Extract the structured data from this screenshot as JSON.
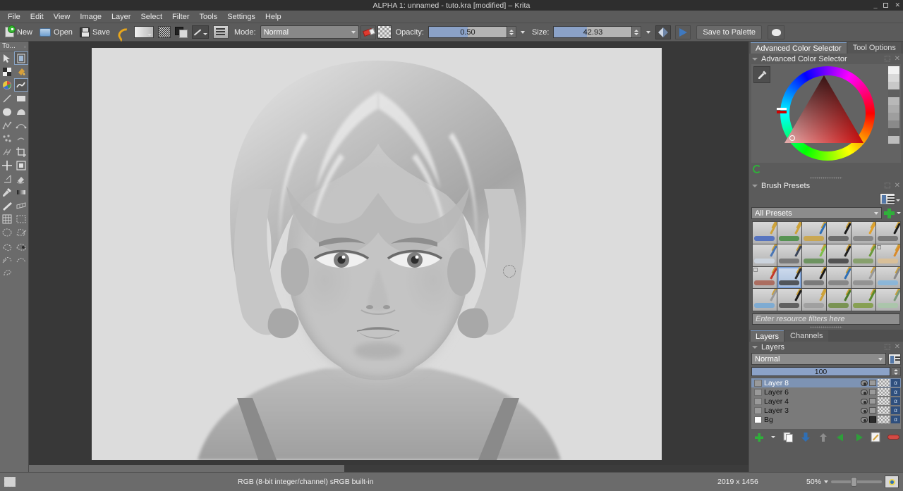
{
  "window": {
    "title": "ALPHA 1: unnamed - tuto.kra [modified] – Krita",
    "minimize": "—",
    "maximize": "□",
    "close": "✕"
  },
  "menubar": {
    "items": [
      {
        "label": "File"
      },
      {
        "label": "Edit"
      },
      {
        "label": "View"
      },
      {
        "label": "Image"
      },
      {
        "label": "Layer"
      },
      {
        "label": "Select"
      },
      {
        "label": "Filter"
      },
      {
        "label": "Tools"
      },
      {
        "label": "Settings"
      },
      {
        "label": "Help"
      }
    ]
  },
  "toolbar": {
    "new_label": "New",
    "open_label": "Open",
    "save_label": "Save",
    "mode_label": "Mode:",
    "mode_value": "Normal",
    "opacity_label": "Opacity:",
    "opacity_value": "0.50",
    "opacity_percent": 50,
    "size_label": "Size:",
    "size_value": "42.93",
    "size_percent": 42,
    "save_to_palette": "Save to Palette",
    "icons": [
      "new-document-icon",
      "open-document-icon",
      "save-document-icon",
      "undo-icon",
      "gradient-swatch-icon",
      "pattern-swatch-icon",
      "foreground-background-color-icon",
      "brush-preset-icon",
      "brush-editor-icon",
      "eraser-toggle-icon",
      "preserve-alpha-icon",
      "mirror-horizontal-icon",
      "wrap-around-icon",
      "workspace-icon"
    ]
  },
  "toolbox": {
    "title": "To...",
    "tools": [
      {
        "name": "select-shapes-tool",
        "selected": false
      },
      {
        "name": "transform-tool",
        "selected": true
      },
      {
        "name": "gradient-tool",
        "selected": false
      },
      {
        "name": "fill-tool",
        "selected": false
      },
      {
        "name": "color-sampler-tool",
        "selected": false
      },
      {
        "name": "freehand-brush-tool",
        "selected": true
      },
      {
        "name": "line-tool",
        "selected": false
      },
      {
        "name": "rectangle-tool",
        "selected": false
      },
      {
        "name": "ellipse-tool",
        "selected": false
      },
      {
        "name": "polygon-tool",
        "selected": false
      },
      {
        "name": "polyline-tool",
        "selected": false
      },
      {
        "name": "bezier-curve-tool",
        "selected": false
      },
      {
        "name": "freehand-path-tool",
        "selected": false
      },
      {
        "name": "dynamic-brush-tool",
        "selected": false
      },
      {
        "name": "multibrush-tool",
        "selected": false
      },
      {
        "name": "crop-tool",
        "selected": false
      },
      {
        "name": "move-tool",
        "selected": false
      },
      {
        "name": "transform-mask-tool",
        "selected": false
      },
      {
        "name": "measure-tool",
        "selected": false
      },
      {
        "name": "fill-bucket-tool",
        "selected": false
      },
      {
        "name": "color-picker-tool",
        "selected": false
      },
      {
        "name": "gradient-edit-tool",
        "selected": false
      },
      {
        "name": "assistant-tool",
        "selected": false
      },
      {
        "name": "perspective-grid-tool",
        "selected": false
      },
      {
        "name": "grid-tool",
        "selected": false
      },
      {
        "name": "select-rectangular-tool",
        "selected": false
      },
      {
        "name": "select-elliptical-tool",
        "selected": false
      },
      {
        "name": "select-polygonal-tool",
        "selected": false
      },
      {
        "name": "select-freehand-tool",
        "selected": false
      },
      {
        "name": "select-contiguous-tool",
        "selected": false
      },
      {
        "name": "select-similar-tool",
        "selected": false
      },
      {
        "name": "select-bezier-tool",
        "selected": false
      },
      {
        "name": "select-magnetic-tool",
        "selected": false
      }
    ]
  },
  "canvas": {
    "artwork_description": "grayscale portrait painting of a short-haired figure",
    "scrollbar": "horizontal-scrollbar",
    "cursor": "brush-outline-cursor"
  },
  "docker": {
    "top_tabs": [
      {
        "label": "Advanced Color Selector",
        "active": true
      },
      {
        "label": "Tool Options",
        "active": false
      }
    ],
    "color_selector": {
      "title": "Advanced Color Selector",
      "accent_hue": "#e01010",
      "shade_swatches": [
        "#f2f2f2",
        "#d9d9d9",
        "#c8c8c8",
        "#5f5f5f",
        "#b8b8b8",
        "#ababab",
        "#9e9e9e",
        "#8a8a8a",
        "#5f5f5f",
        "#bdbdbd"
      ]
    },
    "brush_presets": {
      "title": "Brush Presets",
      "filter_select": "All Presets",
      "filter_placeholder": "Enter resource filters here",
      "selected_index": 13,
      "cells": [
        {
          "stroke": "#3f63c0",
          "nib": "#cda23a"
        },
        {
          "stroke": "#3f8a3a",
          "nib": "#cda23a"
        },
        {
          "stroke": "#cda23a",
          "nib": "#2f6fb5"
        },
        {
          "stroke": "#5a5a5a",
          "nib": "#1a1a1a"
        },
        {
          "stroke": "#7a7a7a",
          "nib": "#e2a12a"
        },
        {
          "stroke": "#6a6a6a",
          "nib": "#1a1a1a"
        },
        {
          "stroke": "#cfd9e6",
          "nib": "#4a76b5"
        },
        {
          "stroke": "#6a6a6a",
          "nib": "#3b4559"
        },
        {
          "stroke": "#5a8a4a",
          "nib": "#7fbf4a"
        },
        {
          "stroke": "#3a3a3a",
          "nib": "#202020"
        },
        {
          "stroke": "#7a9a5a",
          "nib": "#6a9a3a"
        },
        {
          "stroke": "#e0c090",
          "nib": "#d98a2a"
        },
        {
          "stroke": "#a85a4a",
          "nib": "#c23a2a"
        },
        {
          "stroke": "#3a3a3a",
          "nib": "#2a2a2a"
        },
        {
          "stroke": "#6a6a6a",
          "nib": "#1a1a1a"
        },
        {
          "stroke": "#7a7a7a",
          "nib": "#2f6fb5"
        },
        {
          "stroke": "#8a8a8a",
          "nib": "#9a9a9a"
        },
        {
          "stroke": "#7fb5e0",
          "nib": "#8a8a8a"
        },
        {
          "stroke": "#6fa8d8",
          "nib": "#9a9a9a"
        },
        {
          "stroke": "#4a4a4a",
          "nib": "#1a1a1a"
        },
        {
          "stroke": "#9a9a9a",
          "nib": "#cda23a"
        },
        {
          "stroke": "#6a8a3a",
          "nib": "#4a7a2a"
        },
        {
          "stroke": "#7a9a3a",
          "nib": "#5a8a2a"
        },
        {
          "stroke": "#a8c8a8",
          "nib": "#7a9a7a"
        }
      ]
    },
    "bottom_tabs": [
      {
        "label": "Layers",
        "active": true
      },
      {
        "label": "Channels",
        "active": false
      }
    ],
    "layers": {
      "title": "Layers",
      "blend_mode": "Normal",
      "opacity_value": "100",
      "opacity_percent": 100,
      "rows": [
        {
          "name": "Layer 8",
          "selected": true,
          "visible": true,
          "locked": false,
          "bg": false
        },
        {
          "name": "Layer 6",
          "selected": false,
          "visible": true,
          "locked": false,
          "bg": false
        },
        {
          "name": "Layer 4",
          "selected": false,
          "visible": true,
          "locked": false,
          "bg": false
        },
        {
          "name": "Layer 3",
          "selected": false,
          "visible": true,
          "locked": false,
          "bg": false
        },
        {
          "name": "Bg",
          "selected": false,
          "visible": true,
          "locked": true,
          "bg": true
        }
      ],
      "buttons": [
        "add-layer-button",
        "add-layer-dropdown",
        "duplicate-layer-button",
        "move-layer-down-button",
        "move-layer-up-button",
        "layer-left-button",
        "layer-right-button",
        "layer-properties-button",
        "delete-layer-button"
      ]
    }
  },
  "statusbar": {
    "selection_icon": "selection-mask-icon",
    "color_space": "RGB (8-bit integer/channel)  sRGB built-in",
    "dimensions": "2019 x 1456",
    "zoom_level": "50%",
    "zoom_percent": 50,
    "fit_icon": "fit-to-canvas-icon"
  }
}
